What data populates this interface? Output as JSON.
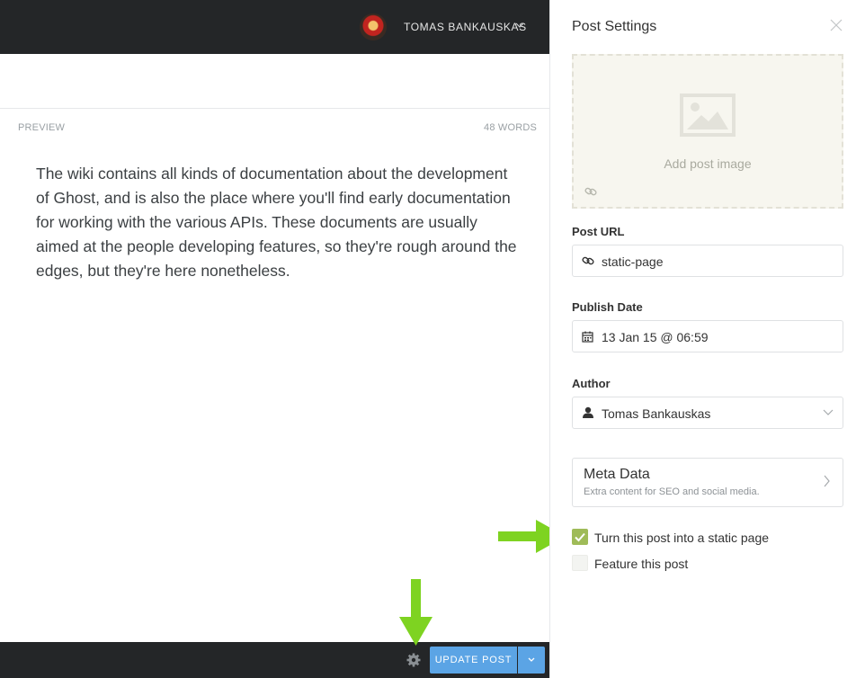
{
  "header": {
    "user_name": "TOMAS BANKAUSKAS"
  },
  "editor": {
    "preview_label": "PREVIEW",
    "word_count": "48 WORDS",
    "preview_text": "The wiki contains all kinds of documentation about the development of Ghost, and is also the place where you'll find early documentation for working with the various APIs. These documents are usually aimed at the people developing features, so they're rough around the edges, but they're here nonetheless."
  },
  "footer": {
    "update_label": "UPDATE POST",
    "accent_color": "#5ba4e5"
  },
  "settings": {
    "title": "Post Settings",
    "add_image_label": "Add post image",
    "post_url": {
      "label": "Post URL",
      "value": "static-page"
    },
    "publish_date": {
      "label": "Publish Date",
      "value": "13 Jan 15 @ 06:59"
    },
    "author": {
      "label": "Author",
      "value": "Tomas Bankauskas"
    },
    "meta": {
      "title": "Meta Data",
      "subtitle": "Extra content for SEO and social media."
    },
    "static_page": {
      "label": "Turn this post into a static page",
      "checked": true,
      "color": "#9fbb58"
    },
    "feature_post": {
      "label": "Feature this post",
      "checked": false
    }
  },
  "annotations": {
    "arrow_color": "#7ed321"
  }
}
